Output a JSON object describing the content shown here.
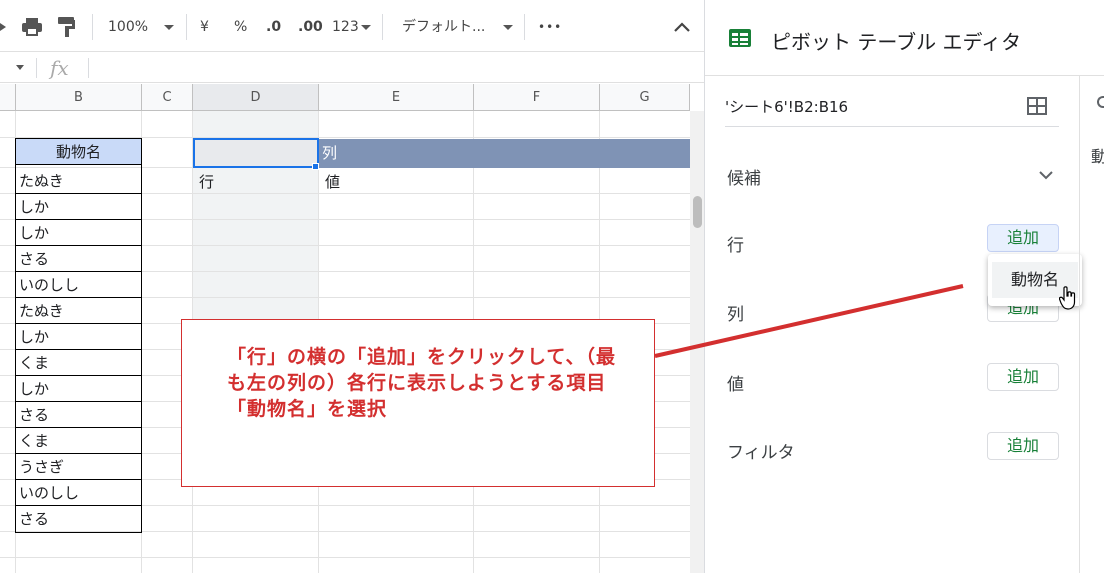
{
  "toolbar": {
    "zoom": "100%",
    "currency": "¥",
    "percent": "%",
    "dec_less": ".0",
    "dec_more": ".00",
    "number_format": "123",
    "font": "デフォルト...",
    "more": "•••"
  },
  "formula_bar": {
    "fx": "fx"
  },
  "grid": {
    "columns": [
      "B",
      "C",
      "D",
      "E",
      "F",
      "G"
    ],
    "animal_header": "動物名",
    "animals": [
      "たぬき",
      "しか",
      "しか",
      "さる",
      "いのしし",
      "たぬき",
      "しか",
      "くま",
      "しか",
      "さる",
      "くま",
      "うさぎ",
      "いのしし",
      "さる"
    ],
    "pivot_col_label": "列",
    "pivot_row_label": "行",
    "pivot_value_label": "値"
  },
  "panel": {
    "title": "ピボット テーブル エディタ",
    "range": "'シート6'!B2:B16",
    "candidates": "候補",
    "rows": "行",
    "columns": "列",
    "values": "値",
    "filter": "フィルタ",
    "add": "追加",
    "dropdown_item": "動物名",
    "side_peek": "動"
  },
  "annotation": {
    "text": "「行」の横の「追加」をクリックして、（最も左の列の）各行に表示しようとする項目「動物名」を選択"
  },
  "colors": {
    "pivot_header": "#7f93b5",
    "animal_header_bg": "#c9daf8",
    "accent_green": "#188038",
    "annotation_red": "#d32f2f"
  }
}
